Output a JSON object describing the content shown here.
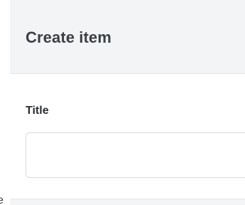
{
  "dialog": {
    "title": "Create item",
    "fields": {
      "title": {
        "label": "Title",
        "value": "",
        "placeholder": ""
      }
    }
  },
  "background": {
    "clipped_text": "e"
  }
}
